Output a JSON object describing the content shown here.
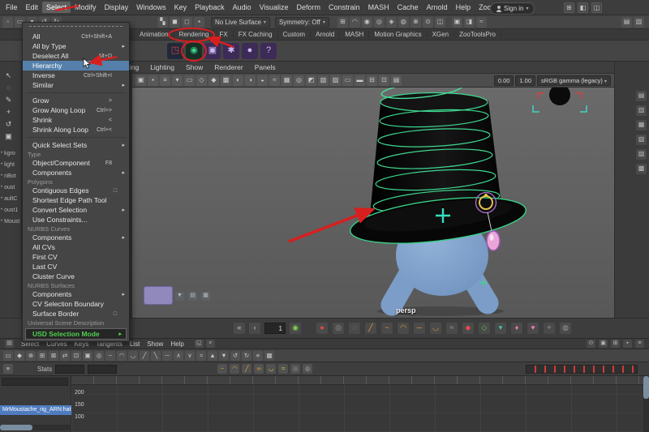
{
  "colors": {
    "annotation_red": "#d81f1f",
    "selection_green": "#3fd68f",
    "highlight_blue": "#5580ab",
    "usd_green": "#4fd04f",
    "character_blue": "#7b9dc8"
  },
  "menubar": {
    "items": [
      {
        "label": "File"
      },
      {
        "label": "Edit"
      },
      {
        "label": "Select",
        "cls": "active"
      },
      {
        "label": "Modify"
      },
      {
        "label": "Display"
      },
      {
        "label": "Windows"
      },
      {
        "label": "Key"
      },
      {
        "label": "Playback"
      },
      {
        "label": "Audio"
      },
      {
        "label": "Visualize"
      },
      {
        "label": "Deform"
      },
      {
        "label": "Constrain"
      },
      {
        "label": "MASH"
      },
      {
        "label": "Cache"
      },
      {
        "label": "Arnold"
      },
      {
        "label": "Help"
      },
      {
        "label": "Zoo Tools"
      }
    ],
    "sign_in": "Sign in",
    "caret": "▾",
    "right_icons": [
      {
        "n": "workspace-icon",
        "g": "⊞"
      },
      {
        "n": "single-pane-icon",
        "g": "◧"
      },
      {
        "n": "four-pane-icon",
        "g": "◫"
      }
    ]
  },
  "statusline": {
    "file_icons": [
      {
        "n": "new-scene-icon",
        "g": "▫"
      },
      {
        "n": "open-scene-icon",
        "g": "▭"
      },
      {
        "n": "save-scene-icon",
        "g": "▾"
      },
      {
        "n": "undo-icon",
        "g": "↺"
      },
      {
        "n": "redo-icon",
        "g": "↻"
      }
    ],
    "mask_icons": [
      {
        "n": "select-hierarchy-icon",
        "g": "▚"
      },
      {
        "n": "select-object-icon",
        "g": "◼"
      },
      {
        "n": "select-component-icon",
        "g": "◻"
      },
      {
        "n": "snap-toggle-icon",
        "g": "▪"
      }
    ],
    "live_surface": "No Live Surface",
    "symmetry": "Symmetry: Off",
    "caret": "▾",
    "snap_icons": [
      {
        "n": "snap-grid-icon",
        "g": "⊞"
      },
      {
        "n": "snap-curve-icon",
        "g": "◠"
      },
      {
        "n": "snap-point-icon",
        "g": "◉"
      },
      {
        "n": "snap-projected-center-icon",
        "g": "◎"
      },
      {
        "n": "snap-view-plane-icon",
        "g": "◈"
      },
      {
        "n": "make-live-icon",
        "g": "◍"
      },
      {
        "n": "universal-manip-icon",
        "g": "⊕"
      },
      {
        "n": "soft-select-icon",
        "g": "⊙"
      },
      {
        "n": "symmetry-icon",
        "g": "◫"
      }
    ],
    "render_icons": [
      {
        "n": "render-frame-icon",
        "g": "▣"
      },
      {
        "n": "ipr-render-icon",
        "g": "◨"
      },
      {
        "n": "render-settings-icon",
        "g": "≈"
      }
    ],
    "right_icons": [
      {
        "n": "paint-effects-icon",
        "g": "▤"
      },
      {
        "n": "texture-view-icon",
        "g": "▥"
      }
    ]
  },
  "shelf": {
    "tabs": [
      {
        "label": "Animation"
      },
      {
        "label": "Rendering"
      },
      {
        "label": "FX"
      },
      {
        "label": "FX Caching"
      },
      {
        "label": "Custom"
      },
      {
        "label": "Arnold"
      },
      {
        "label": "MASH"
      },
      {
        "label": "Motion Graphics"
      },
      {
        "label": "XGen"
      },
      {
        "label": "ZooToolsPro"
      }
    ],
    "icons": [
      {
        "n": "render-view-icon",
        "g": "◳",
        "cls": "sb-dark"
      },
      {
        "n": "render-globals-icon",
        "g": "◉",
        "cls": "sb-green"
      },
      {
        "n": "camera-icon",
        "g": "▣",
        "cls": "sb-purple"
      },
      {
        "n": "settings-gear-icon",
        "g": "✱",
        "cls": "sb-purple"
      },
      {
        "n": "sphere-icon",
        "g": "●",
        "cls": "sb-purple"
      },
      {
        "n": "help-icon",
        "g": "?",
        "cls": "sb-purple"
      }
    ]
  },
  "select_menu": {
    "items": [
      {
        "cls": "tear"
      },
      {
        "label": "All",
        "shortcut": "Ctrl+Shift+A"
      },
      {
        "label": "All by Type",
        "arrow": "▸"
      },
      {
        "label": "Deselect All",
        "shortcut": "Alt+D"
      },
      {
        "label": "Hierarchy",
        "cls": "hl"
      },
      {
        "label": "Inverse",
        "shortcut": "Ctrl+Shift+I"
      },
      {
        "label": "Similar",
        "arrow": "▸"
      },
      {
        "cls": "sep"
      },
      {
        "label": "Grow",
        "shortcut": ">"
      },
      {
        "label": "Grow Along Loop",
        "shortcut": "Ctrl+>"
      },
      {
        "label": "Shrink",
        "shortcut": "<"
      },
      {
        "label": "Shrink Along Loop",
        "shortcut": "Ctrl+<"
      },
      {
        "cls": "sep"
      },
      {
        "label": "Quick Select Sets",
        "arrow": "▸"
      },
      {
        "label": "Type",
        "cls": "section"
      },
      {
        "label": "Object/Component",
        "shortcut": "F8"
      },
      {
        "label": "Components",
        "arrow": "▸"
      },
      {
        "label": "Polygons",
        "cls": "section"
      },
      {
        "label": "Contiguous Edges",
        "opt": "□"
      },
      {
        "label": "Shortest Edge Path Tool"
      },
      {
        "label": "Convert Selection",
        "arrow": "▸"
      },
      {
        "label": "Use Constraints..."
      },
      {
        "label": "NURBS Curves",
        "cls": "section"
      },
      {
        "label": "Components",
        "arrow": "▸"
      },
      {
        "label": "All CVs"
      },
      {
        "label": "First CV"
      },
      {
        "label": "Last CV"
      },
      {
        "label": "Cluster Curve"
      },
      {
        "label": "NURBS Surfaces",
        "cls": "section"
      },
      {
        "label": "Components",
        "arrow": "▸"
      },
      {
        "label": "CV Selection Boundary"
      },
      {
        "label": "Surface Border",
        "opt": "□"
      },
      {
        "label": "Universal Scene Description",
        "cls": "section"
      },
      {
        "label": "USD Selection Mode",
        "cls": "usd",
        "arrow": "▸"
      }
    ]
  },
  "viewport": {
    "menus": [
      {
        "label": "Shading"
      },
      {
        "label": "Lighting"
      },
      {
        "label": "Show"
      },
      {
        "label": "Renderer"
      },
      {
        "label": "Panels"
      }
    ],
    "toolbar_icons": [
      {
        "n": "select-camera-icon",
        "g": "▣"
      },
      {
        "n": "lock-camera-icon",
        "g": "▪"
      },
      {
        "n": "camera-attributes-icon",
        "g": "≡"
      },
      {
        "n": "bookmarks-icon",
        "g": "▾"
      },
      {
        "n": "image-plane-icon",
        "g": "▭"
      },
      {
        "n": "wireframe-mode-icon",
        "g": "◇"
      },
      {
        "n": "shaded-mode-icon",
        "g": "◆"
      },
      {
        "n": "textured-mode-icon",
        "g": "▩"
      },
      {
        "n": "use-all-lights-icon",
        "g": "◐"
      },
      {
        "n": "shadows-icon",
        "g": "◑"
      },
      {
        "n": "occlusion-icon",
        "g": "◒"
      },
      {
        "n": "motion-blur-icon",
        "g": "≈"
      },
      {
        "n": "multisample-aa-icon",
        "g": "▦"
      },
      {
        "n": "depth-of-field-icon",
        "g": "◎"
      },
      {
        "n": "isolate-select-icon",
        "g": "◩"
      },
      {
        "n": "xray-mode-icon",
        "g": "▧"
      },
      {
        "n": "joint-xray-icon",
        "g": "▨"
      },
      {
        "n": "resolution-gate-icon",
        "g": "▭"
      },
      {
        "n": "gate-mask-icon",
        "g": "▬"
      },
      {
        "n": "field-chart-icon",
        "g": "⊟"
      },
      {
        "n": "safe-action-icon",
        "g": "⊡"
      },
      {
        "n": "heads-up-display-icon",
        "g": "▤"
      }
    ],
    "exposure": "0.00",
    "gamma": "1.00",
    "colorspace": "sRGB gamma (legacy)",
    "caret": "▾",
    "camera_label": "persp"
  },
  "left_toolbox": {
    "icons": [
      {
        "n": "select-tool-icon",
        "g": "↖"
      },
      {
        "n": "lasso-tool-icon",
        "g": "◌"
      },
      {
        "n": "paint-select-tool-icon",
        "g": "✎"
      },
      {
        "n": "move-tool-icon",
        "g": "+"
      },
      {
        "n": "rotate-tool-icon",
        "g": "↺"
      },
      {
        "n": "scale-tool-icon",
        "g": "▣"
      }
    ]
  },
  "left_outliner": {
    "items": [
      {
        "g": "•",
        "label": "kgro"
      },
      {
        "g": "•",
        "label": "light"
      },
      {
        "g": "•",
        "label": "nBot"
      },
      {
        "g": "•",
        "label": "oust"
      },
      {
        "g": "•",
        "label": "aultC"
      },
      {
        "g": "•",
        "label": "oust1"
      },
      {
        "g": "•",
        "label": "Moust"
      }
    ]
  },
  "right_panel": {
    "icons": [
      {
        "n": "channel-box-tab-icon",
        "g": "▤"
      },
      {
        "n": "attribute-editor-tab-icon",
        "g": "▥"
      },
      {
        "n": "tool-settings-tab-icon",
        "g": "▦"
      },
      {
        "n": "modeling-toolkit-tab-icon",
        "g": "▧"
      },
      {
        "n": "character-controls-tab-icon",
        "g": "▨"
      },
      {
        "n": "outliner-tab-icon",
        "g": "▩"
      }
    ]
  },
  "hud": {
    "icons": [
      {
        "n": "isolate-hud-icon",
        "g": "▼"
      },
      {
        "n": "grid-toggle-hud-icon",
        "g": "▤"
      },
      {
        "n": "film-gate-hud-icon",
        "g": "▦"
      }
    ]
  },
  "playback": {
    "go_start_icon": {
      "n": "go-to-start-icon",
      "g": "«"
    },
    "step_back_icon": {
      "n": "step-back-icon",
      "g": "‹"
    },
    "frame_field": "1",
    "power_icon": {
      "n": "playback-power-icon",
      "g": "◉"
    },
    "icons": [
      {
        "n": "auto-key-icon",
        "g": "●",
        "cls": "c-red"
      },
      {
        "n": "anim-ghost-icon",
        "g": "◎",
        "cls": "c-dim"
      },
      {
        "n": "snap-keys-icon",
        "g": "◌",
        "cls": "c-dim"
      },
      {
        "n": "linear-tangent-icon",
        "g": "╱",
        "cls": "c-orange"
      },
      {
        "n": "spline-tangent-icon",
        "g": "~",
        "cls": "c-orange"
      },
      {
        "n": "clamped-tangent-icon",
        "g": "◠",
        "cls": "c-orange"
      },
      {
        "n": "flat-tangent-icon",
        "g": "─",
        "cls": "c-orange"
      },
      {
        "n": "step-tangent-icon",
        "g": "◡",
        "cls": "c-orange"
      },
      {
        "n": "buffer-curves-icon",
        "g": "≈",
        "cls": "c-dim"
      },
      {
        "n": "set-key-icon",
        "g": "◆",
        "cls": "c-red"
      },
      {
        "n": "breakdown-key-icon",
        "g": "◇",
        "cls": "c-green"
      },
      {
        "n": "time-marker-icon",
        "g": "▾",
        "cls": "c-teal"
      },
      {
        "n": "character-set-icon",
        "g": "♦",
        "cls": "c-pink"
      },
      {
        "n": "favorites-heart-icon",
        "g": "♥",
        "cls": "c-pink"
      },
      {
        "n": "skeleton-icon",
        "g": "+",
        "cls": "c-dim"
      },
      {
        "n": "ghosting-icon",
        "g": "◍",
        "cls": "c-dim"
      }
    ]
  },
  "graph_editor": {
    "panel_icon": {
      "n": "panel-menu-icon",
      "g": "▤"
    },
    "menus": [
      {
        "label": "Select"
      },
      {
        "label": "Curves"
      },
      {
        "label": "Keys"
      },
      {
        "label": "Tangents"
      },
      {
        "label": "List"
      },
      {
        "label": "Show"
      },
      {
        "label": "Help"
      }
    ],
    "window_icons": [
      {
        "n": "panel-maximize-icon",
        "g": "◱"
      },
      {
        "n": "panel-close-icon",
        "g": "×"
      }
    ],
    "right_icons": [
      {
        "n": "pin-channel-icon",
        "g": "⊙"
      },
      {
        "n": "ge-camera-icon",
        "g": "▣"
      },
      {
        "n": "ge-grid-icon",
        "g": "⊞"
      },
      {
        "n": "ge-lock-icon",
        "g": "▪"
      },
      {
        "n": "ge-settings-icon",
        "g": "≡"
      }
    ],
    "toolbar1_icons": [
      {
        "n": "move-key-icon",
        "g": "▭"
      },
      {
        "n": "insert-key-icon",
        "g": "◆"
      },
      {
        "n": "add-key-icon",
        "g": "⊕"
      },
      {
        "n": "lattice-deform-icon",
        "g": "⊞"
      },
      {
        "n": "region-select-icon",
        "g": "⊠"
      },
      {
        "n": "retime-tool-icon",
        "g": "⇄"
      },
      {
        "n": "frame-all-icon",
        "g": "⊡"
      },
      {
        "n": "frame-range-icon",
        "g": "▣"
      },
      {
        "n": "center-current-icon",
        "g": "◎"
      },
      {
        "n": "auto-tangent-icon",
        "g": "~"
      },
      {
        "n": "spline-tangent-icon",
        "g": "◠"
      },
      {
        "n": "clamped-tangent-icon",
        "g": "◡"
      },
      {
        "n": "linear-tangent-icon",
        "g": "╱"
      },
      {
        "n": "plateau-tangent-icon",
        "g": "╲"
      },
      {
        "n": "flat-tangent-icon",
        "g": "─"
      },
      {
        "n": "step-in-tangent-icon",
        "g": "∧"
      },
      {
        "n": "step-out-tangent-icon",
        "g": "∨"
      },
      {
        "n": "buffer-snapshot-icon",
        "g": "≈"
      },
      {
        "n": "pre-infinity-icon",
        "g": "▲"
      },
      {
        "n": "post-infinity-icon",
        "g": "▼"
      },
      {
        "n": "undo-view-icon",
        "g": "↺"
      },
      {
        "n": "redo-view-icon",
        "g": "↻"
      },
      {
        "n": "curve-list-icon",
        "g": "≡"
      },
      {
        "n": "isolate-curve-icon",
        "g": "▩"
      }
    ],
    "hamburger_icon": {
      "n": "toolbar-options-icon",
      "g": "≡"
    },
    "stats_label": "Stats",
    "toolbar2_icons": [
      {
        "n": "absolute-view-icon",
        "g": "~",
        "cls": "c-orange"
      },
      {
        "n": "stacked-view-icon",
        "g": "◠",
        "cls": "c-orange"
      },
      {
        "n": "normalized-view-icon",
        "g": "╱",
        "cls": "c-orange"
      },
      {
        "n": "infinity-icon",
        "g": "∞",
        "cls": "c-orange"
      },
      {
        "n": "curve-smooth-icon",
        "g": "◡",
        "cls": "c-yellow"
      },
      {
        "n": "simplify-curve-icon",
        "g": "≈",
        "cls": "c-yellow"
      },
      {
        "n": "time-snap-icon",
        "g": "◎",
        "cls": "c-dim"
      },
      {
        "n": "value-snap-icon",
        "g": "◍",
        "cls": "c-dim"
      }
    ],
    "outliner_items": [
      {
        "label": ""
      },
      {
        "label": ""
      },
      {
        "label": "MrMoustache_rig_ARN:hat",
        "cls": "selected"
      }
    ],
    "y_labels": [
      "200",
      "150",
      "100"
    ]
  }
}
